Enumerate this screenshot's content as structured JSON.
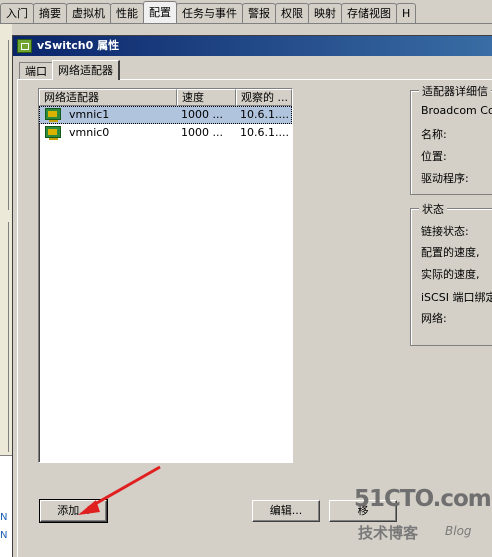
{
  "top_tabs": [
    "入门",
    "摘要",
    "虚拟机",
    "性能",
    "配置",
    "任务与事件",
    "警报",
    "权限",
    "映射",
    "存储视图",
    "H"
  ],
  "top_tab_active": "配置",
  "dialog": {
    "title": "vSwitch0 属性",
    "tabs": [
      "端口",
      "网络适配器"
    ],
    "active_tab": "网络适配器"
  },
  "adapters_table": {
    "columns": [
      "网络适配器",
      "速度",
      "观察的 ..."
    ],
    "rows": [
      {
        "name": "vmnic1",
        "speed": "1000 ...",
        "observed": "10.6.1....",
        "selected": true
      },
      {
        "name": "vmnic0",
        "speed": "1000 ...",
        "observed": "10.6.1....",
        "selected": false
      }
    ]
  },
  "details": {
    "group_title": "适配器详细信",
    "vendor": "Broadcom Corp",
    "name_label": "名称:",
    "location_label": "位置:",
    "driver_label": "驱动程序:"
  },
  "status": {
    "group_title": "状态",
    "link_label": "链接状态:",
    "configured_speed_label": "配置的速度,",
    "actual_speed_label": "实际的速度,",
    "iscsi_label": "iSCSI 端口绑定",
    "network_label": "网络:"
  },
  "buttons": {
    "add": "添加...",
    "edit": "编辑...",
    "remove": "移"
  },
  "bg_left_letters": [
    "N",
    "N"
  ],
  "watermark": {
    "site": "51CTO.com",
    "cn": "技术博客",
    "blog": "Blog"
  }
}
